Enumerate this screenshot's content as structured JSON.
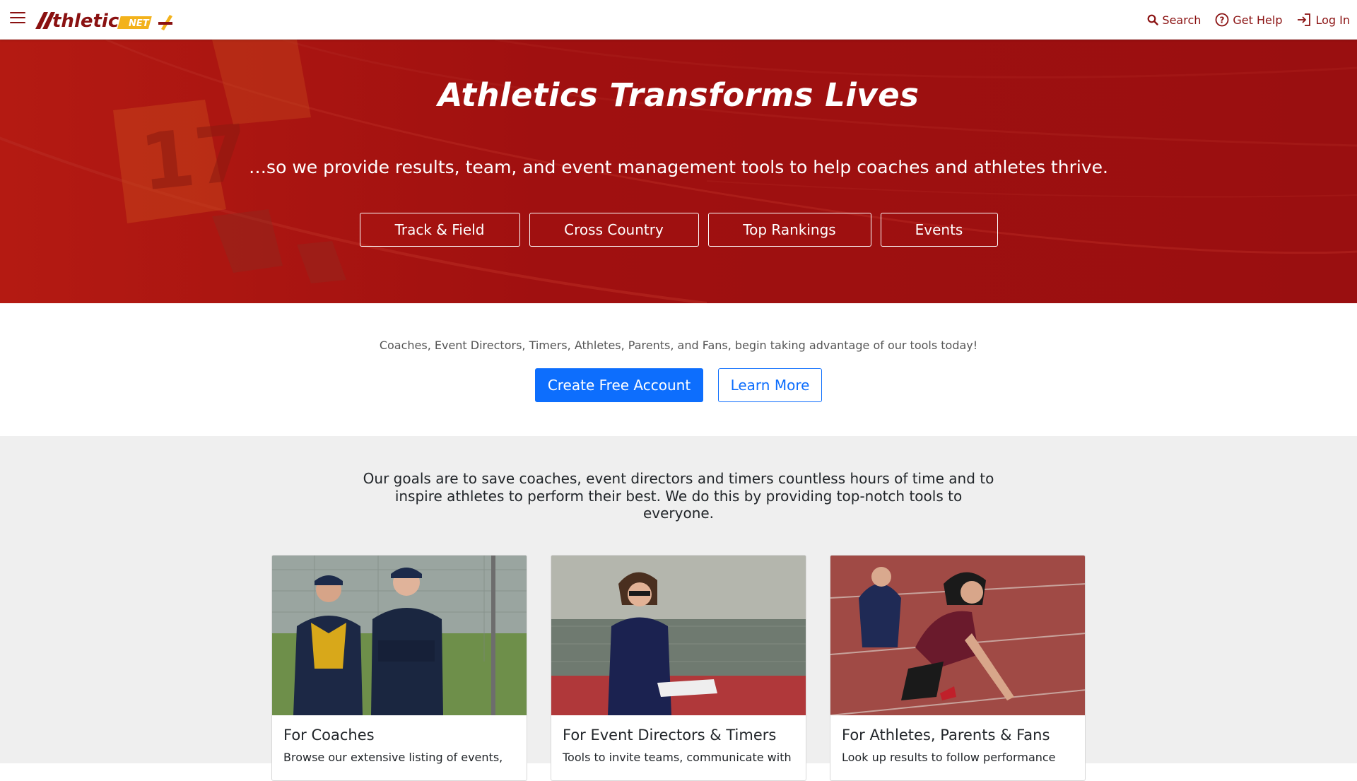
{
  "nav": {
    "brand": "AthleticNET",
    "brand_accent": "NET",
    "links": [
      {
        "label": "Search",
        "icon": "search-icon"
      },
      {
        "label": "Get Help",
        "icon": "help-circle-icon"
      },
      {
        "label": "Log In",
        "icon": "login-icon"
      }
    ]
  },
  "hero": {
    "title": "Athletics Transforms Lives",
    "subtitle": "…so we provide results, team, and event management tools to help coaches and athletes thrive.",
    "buttons": [
      "Track & Field",
      "Cross Country",
      "Top Rankings",
      "Events"
    ]
  },
  "signup": {
    "text": "Coaches, Event Directors, Timers, Athletes, Parents, and Fans, begin taking advantage of our tools today!",
    "create_label": "Create Free Account",
    "learn_label": "Learn More"
  },
  "goals": {
    "text": "Our goals are to save coaches, event directors and timers countless hours of time and to inspire athletes to perform their best. We do this by providing top-notch tools to everyone.",
    "cards": [
      {
        "title": "For Coaches",
        "text": "Browse our extensive listing of events,"
      },
      {
        "title": "For Event Directors & Timers",
        "text": "Tools to invite teams, communicate with"
      },
      {
        "title": "For Athletes, Parents & Fans",
        "text": "Look up results to follow performance"
      }
    ]
  },
  "colors": {
    "brand_red": "#8a1111",
    "hero_red": "#a3100f",
    "primary_blue": "#0d6efd",
    "section_gray": "#efefef"
  }
}
